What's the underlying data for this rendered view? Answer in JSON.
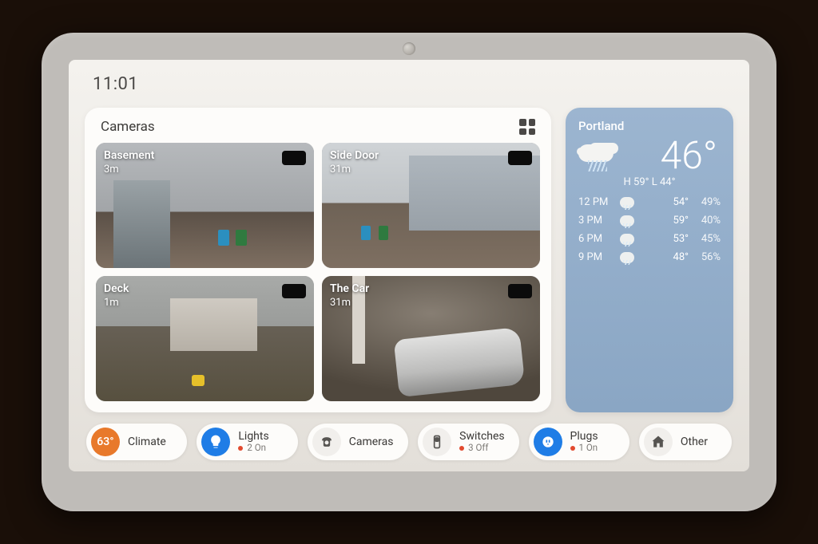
{
  "clock": "11:01",
  "cameras_card": {
    "title": "Cameras",
    "items": [
      {
        "name": "Basement",
        "age": "3m"
      },
      {
        "name": "Side Door",
        "age": "31m"
      },
      {
        "name": "Deck",
        "age": "1m"
      },
      {
        "name": "The Car",
        "age": "31m"
      }
    ]
  },
  "weather": {
    "city": "Portland",
    "temp": "46°",
    "high_low": "H 59°  L 44°",
    "forecast": [
      {
        "time": "12 PM",
        "temp": "54°",
        "humidity": "49%"
      },
      {
        "time": "3 PM",
        "temp": "59°",
        "humidity": "40%"
      },
      {
        "time": "6 PM",
        "temp": "53°",
        "humidity": "45%"
      },
      {
        "time": "9 PM",
        "temp": "48°",
        "humidity": "56%"
      }
    ]
  },
  "pills": {
    "climate": {
      "icon_text": "63°",
      "title": "Climate"
    },
    "lights": {
      "title": "Lights",
      "sub": "2 On"
    },
    "cameras": {
      "title": "Cameras"
    },
    "switches": {
      "title": "Switches",
      "sub": "3 Off"
    },
    "plugs": {
      "title": "Plugs",
      "sub": "1 On"
    },
    "other": {
      "title": "Other"
    }
  }
}
